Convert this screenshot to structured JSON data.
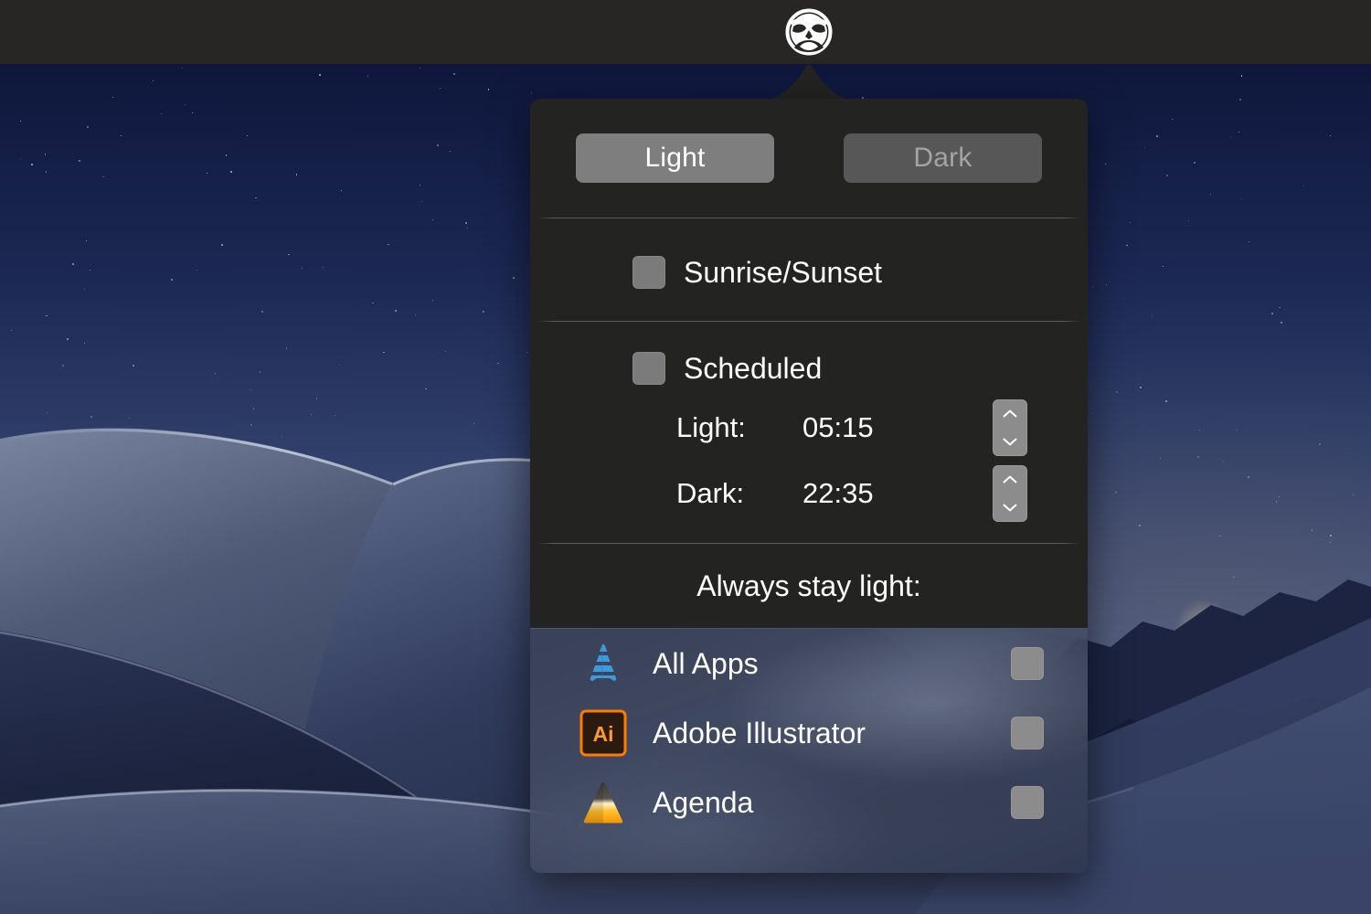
{
  "menubar": {
    "icon_name": "owl-icon",
    "bg_color": "#272624"
  },
  "popover": {
    "mode_toggle": {
      "light_label": "Light",
      "dark_label": "Dark",
      "selected": "Light"
    },
    "sunrise_sunset": {
      "label": "Sunrise/Sunset",
      "checked": false
    },
    "scheduled": {
      "label": "Scheduled",
      "checked": false,
      "light_label": "Light:",
      "light_time": "05:15",
      "dark_label": "Dark:",
      "dark_time": "22:35"
    },
    "always_stay_light": {
      "heading": "Always stay light:",
      "apps": [
        {
          "name": "All Apps",
          "icon": "app-store-icon",
          "checked": false
        },
        {
          "name": "Adobe Illustrator",
          "icon": "adobe-illustrator-icon",
          "checked": false
        },
        {
          "name": "Agenda",
          "icon": "agenda-icon",
          "checked": false
        }
      ]
    }
  },
  "colors": {
    "popover_bg": "#232322",
    "segment_selected": "#7e7e7e",
    "segment_unselected": "#575757",
    "checkbox": "#7b7b7b",
    "stepper": "#8c8c8c",
    "text": "#ffffff",
    "text_dim": "#a4a4a4",
    "illustrator_orange": "#ff7c00",
    "app_store_blue": "#3d9bdc",
    "agenda_orange": "#f5a623"
  }
}
